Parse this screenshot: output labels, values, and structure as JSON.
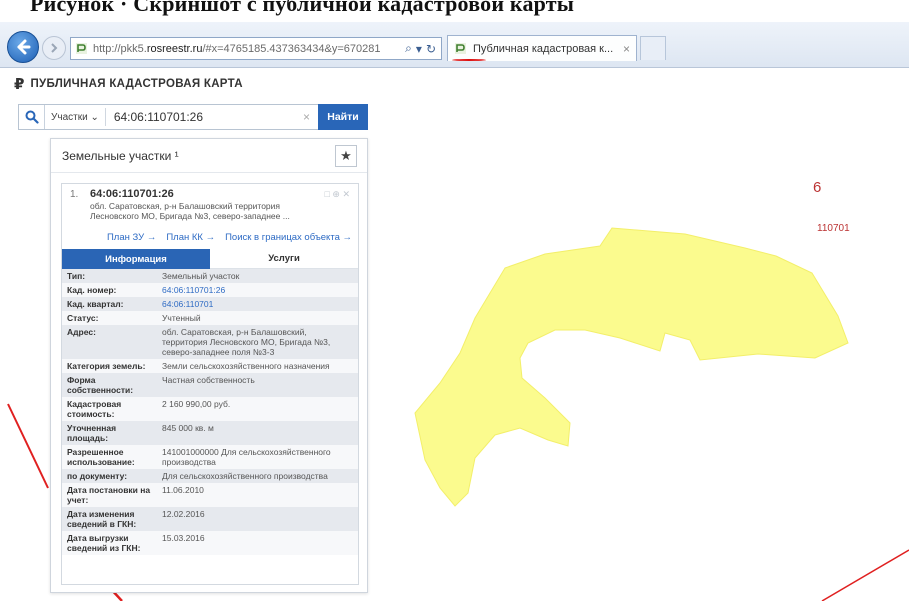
{
  "browser": {
    "url_prefix": "http://pkk5.",
    "url_domain": "rosreestr.ru",
    "url_rest": "/#x=4765185.437363434&y=670281",
    "search_glyph": "⌕",
    "refresh_glyph": "↻",
    "tab_title": "Публичная кадастровая к...",
    "tab_close": "×"
  },
  "site": {
    "logo": "₽",
    "title": "ПУБЛИЧНАЯ КАДАСТРОВАЯ КАРТА"
  },
  "search": {
    "type_label": "Участки ⌄",
    "value": "64:06:110701:26",
    "clear": "×",
    "button_label": "Найти"
  },
  "panel": {
    "title": "Земельные участки ¹",
    "star": "★"
  },
  "card": {
    "number": "1.",
    "cadastral_id": "64:06:110701:26",
    "address": "обл. Саратовская, р-н Балашовский территория Лесновского МО, Бригада №3, северо-западнее ...",
    "controls": "□ ⊕ ✕",
    "links": [
      "План ЗУ →",
      "План КК →",
      "Поиск в границах объекта →"
    ],
    "tab_info": "Информация",
    "tab_services": "Услуги"
  },
  "properties": [
    {
      "key": "Тип:",
      "value": "Земельный участок",
      "link": false
    },
    {
      "key": "Кад. номер:",
      "value": "64:06:110701:26",
      "link": true
    },
    {
      "key": "Кад. квартал:",
      "value": "64:06:110701",
      "link": true
    },
    {
      "key": "Статус:",
      "value": "Учтенный",
      "link": false
    },
    {
      "key": "Адрес:",
      "value": "обл. Саратовская, р-н Балашовский, территория Лесновского МО, Бригада №3, северо-западнее поля №3-3",
      "link": false
    },
    {
      "key": "Категория земель:",
      "value": "Земли сельскохозяйственного назначения",
      "link": false
    },
    {
      "key": "Форма собственности:",
      "value": "Частная собственность",
      "link": false
    },
    {
      "key": "Кадастровая стоимость:",
      "value": "2 160 990,00 руб.",
      "link": false
    },
    {
      "key": "Уточненная площадь:",
      "value": "845 000 кв. м",
      "link": false
    },
    {
      "key": "Разрешенное использование:",
      "value": "141001000000 Для сельскохозяйственного производства",
      "link": false
    },
    {
      "key": "по документу:",
      "value": "Для сельскохозяйственного производства",
      "link": false
    },
    {
      "key": "Дата постановки на учет:",
      "value": "11.06.2010",
      "link": false
    },
    {
      "key": "Дата изменения сведений в ГКН:",
      "value": "12.02.2016",
      "link": false
    },
    {
      "key": "Дата выгрузки сведений из ГКН:",
      "value": "15.03.2016",
      "link": false
    }
  ],
  "map": {
    "label_quarter_number": "6",
    "label_quarter_code": "110701",
    "parcel_color": "#fbfb8e",
    "boundary_color": "#e02020"
  },
  "colors": {
    "accent": "#2966b8",
    "link": "#2e6bc4"
  }
}
